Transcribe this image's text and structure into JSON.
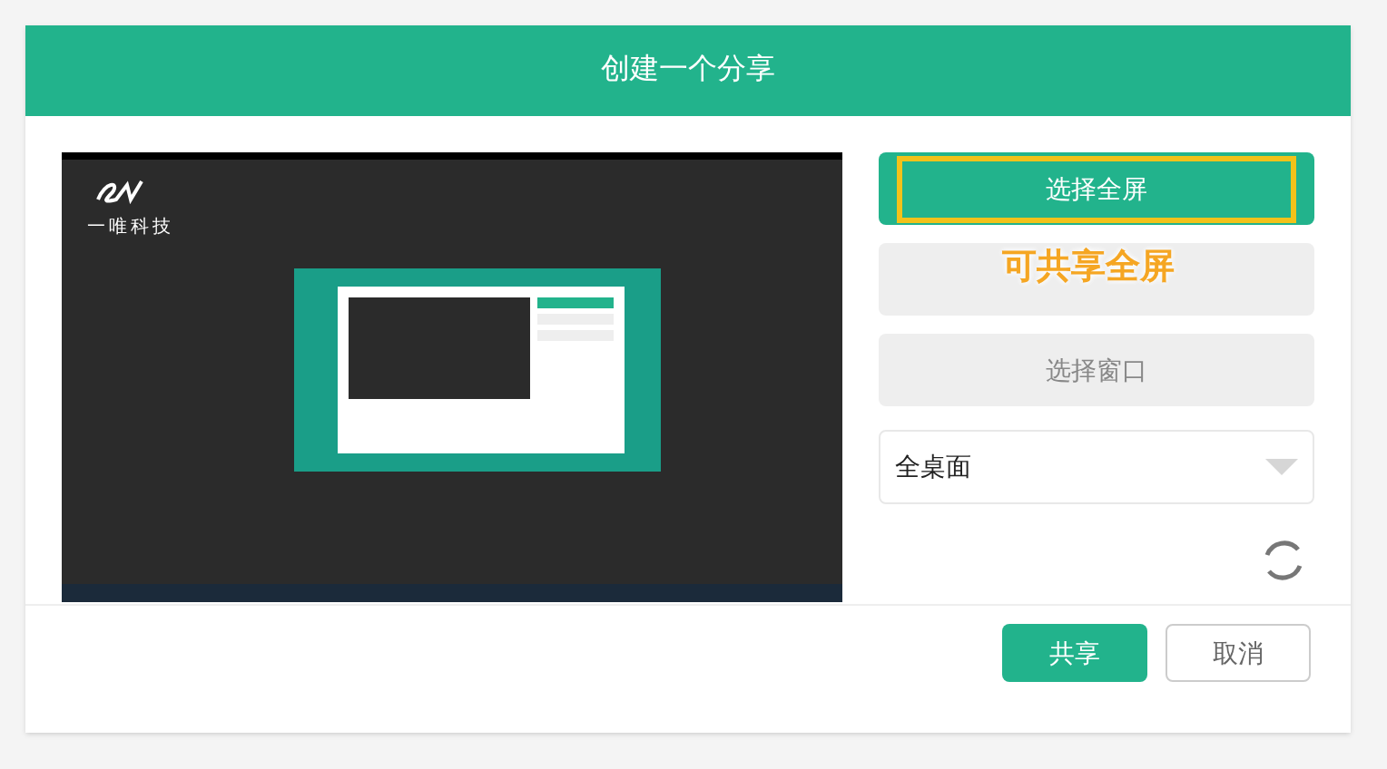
{
  "dialog": {
    "title": "创建一个分享"
  },
  "preview": {
    "logo_text": "一唯科技"
  },
  "modes": [
    {
      "label": "选择全屏",
      "selected": true
    },
    {
      "selected": false
    },
    {
      "label": "选择窗口",
      "selected": false
    }
  ],
  "screen_select": {
    "value": "全桌面"
  },
  "annotation": {
    "text": "可共享全屏"
  },
  "buttons": [
    {
      "label": "共享",
      "kind": "primary"
    },
    {
      "label": "取消",
      "kind": "secondary"
    }
  ]
}
